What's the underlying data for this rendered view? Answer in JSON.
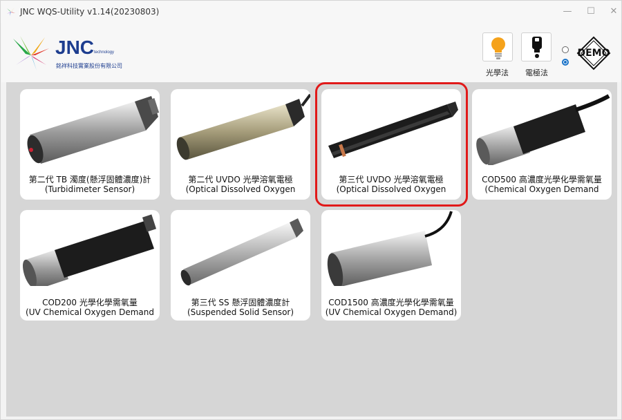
{
  "window": {
    "title": "JNC WQS-Utility v1.14(20230803)",
    "minimize": "—",
    "maximize": "☐",
    "close": "✕"
  },
  "header": {
    "logo_text": "JNC",
    "logo_sub": "technology",
    "company_name": "銘祥科技實業股份有限公司",
    "optical_method_label": "光學法",
    "electrode_method_label": "電極法",
    "demo_label": "DEMO",
    "optical_icon": "lightbulb-icon",
    "electrode_icon": "electrode-icon"
  },
  "colors": {
    "accent": "#1a73c8",
    "highlight": "#e11919",
    "brand": "#1d3d8f"
  },
  "sensors": [
    {
      "line1": "第二代 TB 濁度(懸浮固體濃度)計",
      "line2": "(Turbidimeter Sensor)"
    },
    {
      "line1": "第二代 UVDO 光學溶氧電極",
      "line2": "(Optical Dissolved Oxygen"
    },
    {
      "line1": "第三代 UVDO 光學溶氧電極",
      "line2": "(Optical Dissolved Oxygen"
    },
    {
      "line1": "COD500 高濃度光學化學需氧量",
      "line2": "(Chemical Oxygen Demand"
    },
    {
      "line1": "COD200 光學化學需氧量",
      "line2": "(UV Chemical Oxygen Demand"
    },
    {
      "line1": "第三代 SS 懸浮固體濃度計",
      "line2": "(Suspended Solid Sensor)"
    },
    {
      "line1": "COD1500 高濃度光學化學需氧量",
      "line2": "(UV Chemical Oxygen Demand)"
    }
  ]
}
